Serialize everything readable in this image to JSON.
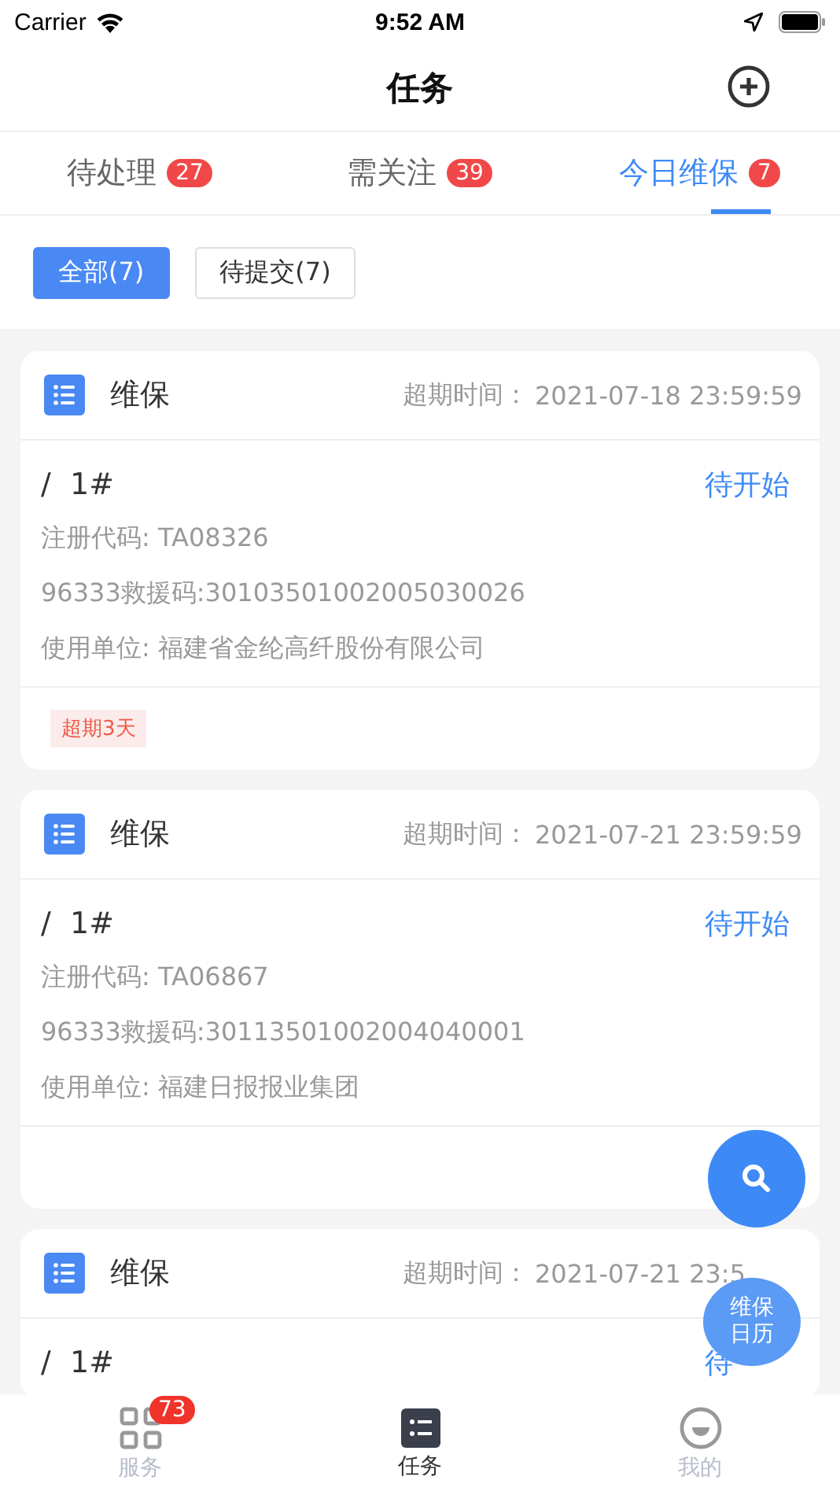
{
  "status_bar": {
    "carrier": "Carrier",
    "time": "9:52 AM"
  },
  "nav": {
    "title": "任务"
  },
  "tabs": [
    {
      "label": "待处理",
      "count": "27",
      "selected": false
    },
    {
      "label": "需关注",
      "count": "39",
      "selected": false
    },
    {
      "label": "今日维保",
      "count": "7",
      "selected": true
    }
  ],
  "filters": [
    {
      "label": "全部(7)",
      "selected": true
    },
    {
      "label": "待提交(7)",
      "selected": false
    }
  ],
  "tasks": [
    {
      "type": "维保",
      "deadline_label": "超期时间：",
      "deadline": "2021-07-18 23:59:59",
      "name": "/  1#",
      "status": "待开始",
      "fields": [
        "注册代码: TA08326",
        "96333救援码:30103501002005030026",
        "使用单位: 福建省金纶高纤股份有限公司"
      ],
      "tag": "超期3天"
    },
    {
      "type": "维保",
      "deadline_label": "超期时间：",
      "deadline": "2021-07-21 23:59:59",
      "name": "/  1#",
      "status": "待开始",
      "fields": [
        "注册代码: TA06867",
        "96333救援码:30113501002004040001",
        "使用单位: 福建日报报业集团"
      ]
    },
    {
      "type": "维保",
      "deadline_label": "超期时间：",
      "deadline": "2021-07-21 23:5",
      "name": "/  1#",
      "status": "待"
    }
  ],
  "calendar_button": {
    "label": "维保日历"
  },
  "bottom_tabs": [
    {
      "kind": "grid",
      "label": "服务",
      "badge": "73",
      "selected": false
    },
    {
      "kind": "list",
      "label": "任务",
      "selected": true
    },
    {
      "kind": "face",
      "label": "我的",
      "selected": false
    }
  ]
}
